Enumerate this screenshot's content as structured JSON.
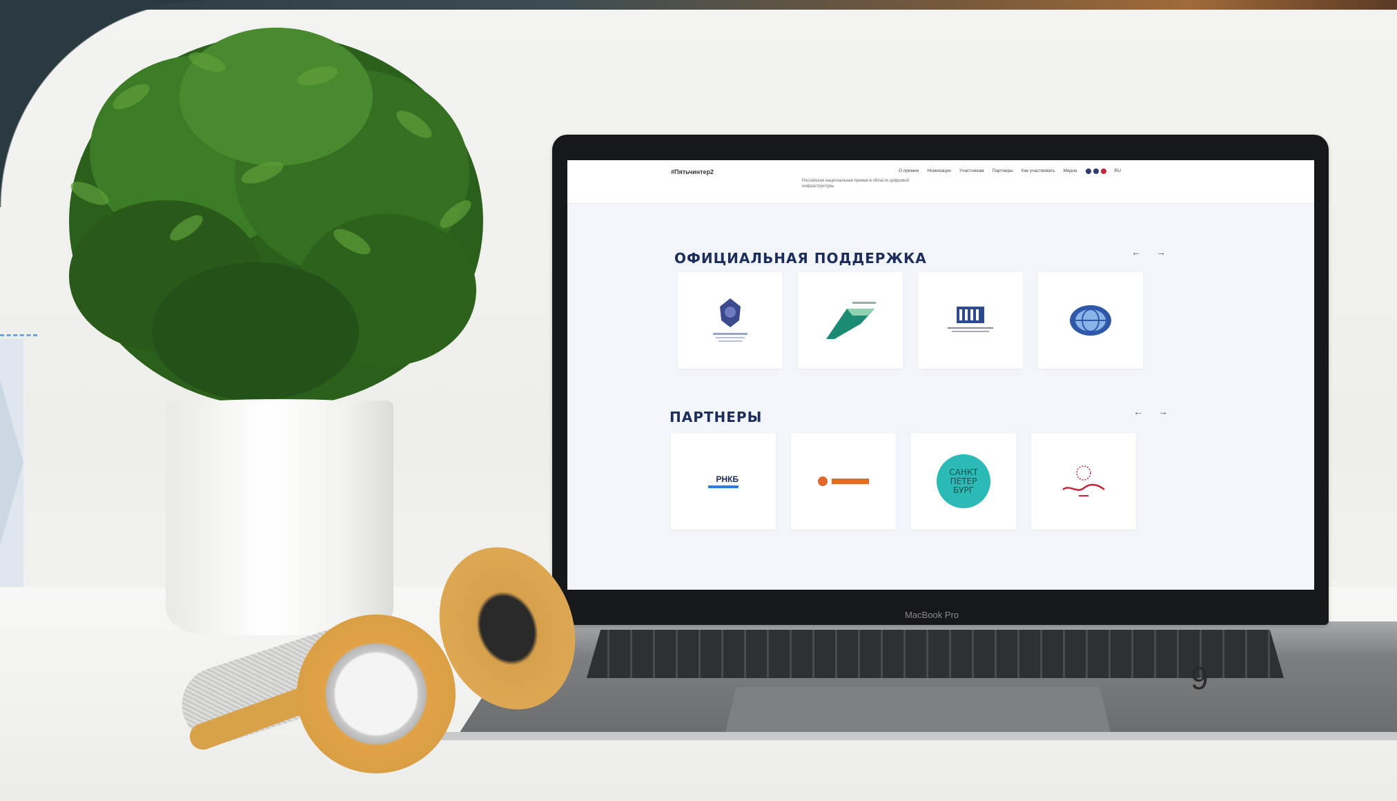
{
  "website": {
    "logo_text": "#Пятьчинтер2",
    "tagline": "Российская национальная премия в области цифровой инфраструктуры",
    "nav": [
      "О премии",
      "Номинации",
      "Участникам",
      "Партнеры",
      "Как участвовать",
      "Медиа"
    ],
    "language": "RU",
    "section_support_title": "ОФИЦИАЛЬНАЯ ПОДДЕРЖКА",
    "section_partners_title": "ПАРТНЕРЫ",
    "prev_arrow": "←",
    "next_arrow": "→",
    "support_logos": [
      "ministry-emblem-logo",
      "green-arrow-logo",
      "building-logo",
      "globe-logo"
    ],
    "partner_logos": [
      "bank-logo",
      "orange-logo",
      "saint-petersburg-logo",
      "red-script-logo"
    ],
    "partner_text": {
      "bank": "РНКБ",
      "spb_line1": "САНКТ",
      "spb_line2": "ПЕТЕР",
      "spb_line3": "БУРГ"
    }
  },
  "device_label": "MacBook Pro",
  "page_number": "9",
  "colors": {
    "accent_navy": "#1d2d5a",
    "teal": "#2bbab5",
    "orange": "#e26a2c",
    "red": "#c0273b"
  }
}
